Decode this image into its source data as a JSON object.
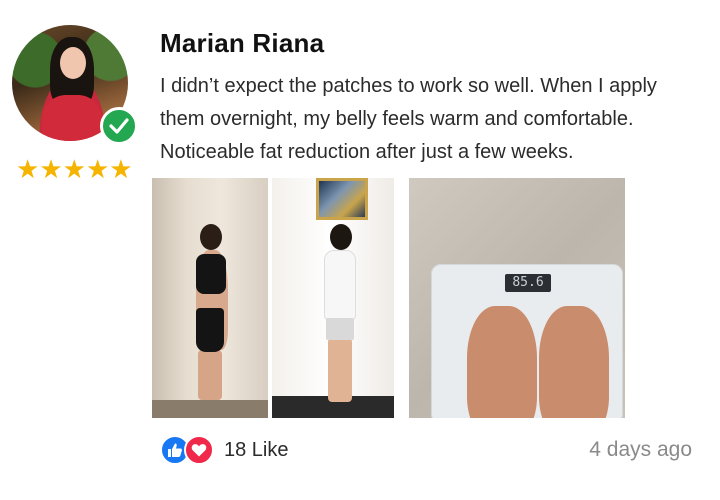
{
  "reviewer": {
    "name": "Marian Riana",
    "avatar_icon": "user-avatar",
    "verified_icon": "verified-check-icon",
    "rating_stars": 5
  },
  "review": {
    "text": "I didn’t expect the patches to work so well. When I apply them overnight, my belly feels warm and comfortable. Noticeable fat reduction after just a few weeks.",
    "photos": [
      {
        "name": "before-side-photo"
      },
      {
        "name": "after-side-photo"
      },
      {
        "name": "scale-photo",
        "scale_reading": "85.6"
      }
    ]
  },
  "footer": {
    "like_count_label": "18 Like",
    "timestamp": "4 days ago",
    "reaction_icons": [
      "like-icon",
      "love-icon"
    ]
  },
  "colors": {
    "stars": "#f5b400",
    "verified": "#23a851",
    "like": "#1877f2",
    "love": "#f02849",
    "timestamp": "#8a8a8a"
  }
}
